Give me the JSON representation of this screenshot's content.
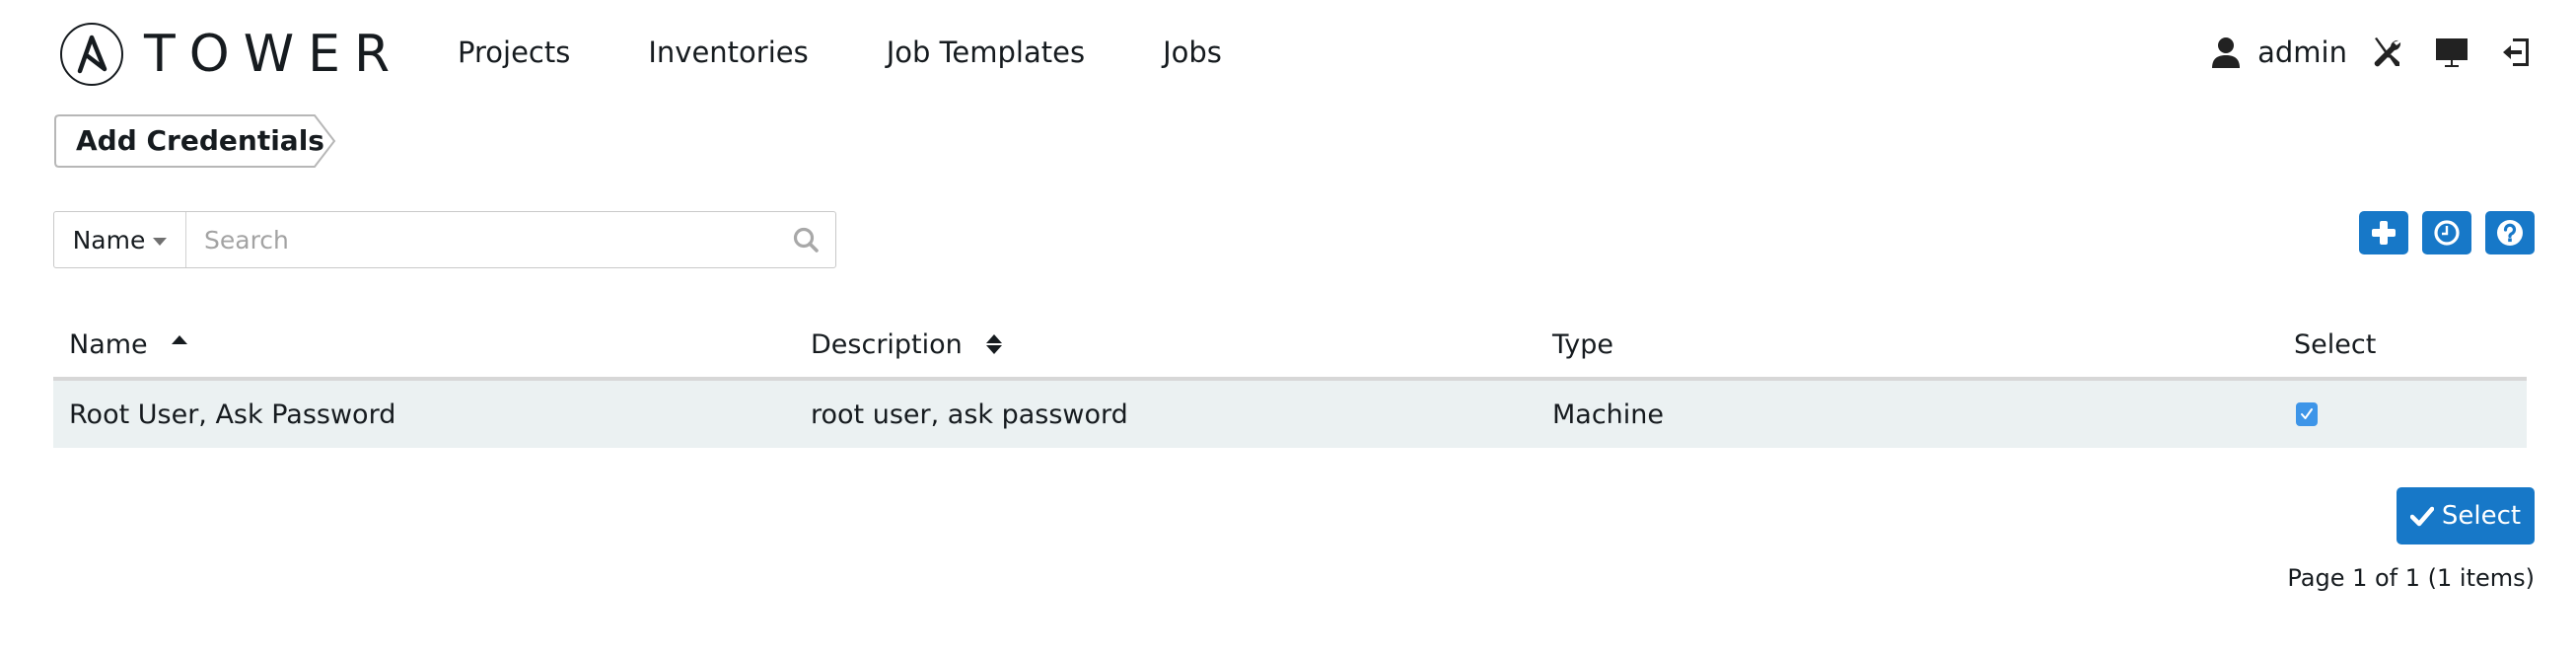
{
  "header": {
    "brand": "TOWER",
    "nav": [
      {
        "label": "Projects"
      },
      {
        "label": "Inventories"
      },
      {
        "label": "Job Templates"
      },
      {
        "label": "Jobs"
      }
    ],
    "user": {
      "name": "admin",
      "icon": "user-icon"
    },
    "tools": [
      {
        "icon": "tools-icon"
      },
      {
        "icon": "monitor-icon"
      },
      {
        "icon": "logout-icon"
      }
    ]
  },
  "breadcrumb": {
    "label": "Add Credentials"
  },
  "search": {
    "field_label": "Name",
    "placeholder": "Search",
    "value": ""
  },
  "actions": [
    {
      "icon": "plus-icon",
      "label": "Add"
    },
    {
      "icon": "clock-icon",
      "label": "Activity stream"
    },
    {
      "icon": "question-icon",
      "label": "Help"
    }
  ],
  "table": {
    "columns": [
      {
        "label": "Name",
        "sort": "ascending"
      },
      {
        "label": "Description",
        "sort": "sortable"
      },
      {
        "label": "Type",
        "sort": "none"
      },
      {
        "label": "Select",
        "sort": "none"
      }
    ],
    "rows": [
      {
        "name": "Root User, Ask Password",
        "description": "root user, ask password",
        "type": "Machine",
        "selected": true
      }
    ]
  },
  "footer": {
    "select_label": "Select",
    "pager": "Page 1 of 1 (1 items)"
  },
  "colors": {
    "primary": "#1778c8",
    "checkbox": "#3d95e8",
    "row_highlight": "#ebf1f2"
  }
}
